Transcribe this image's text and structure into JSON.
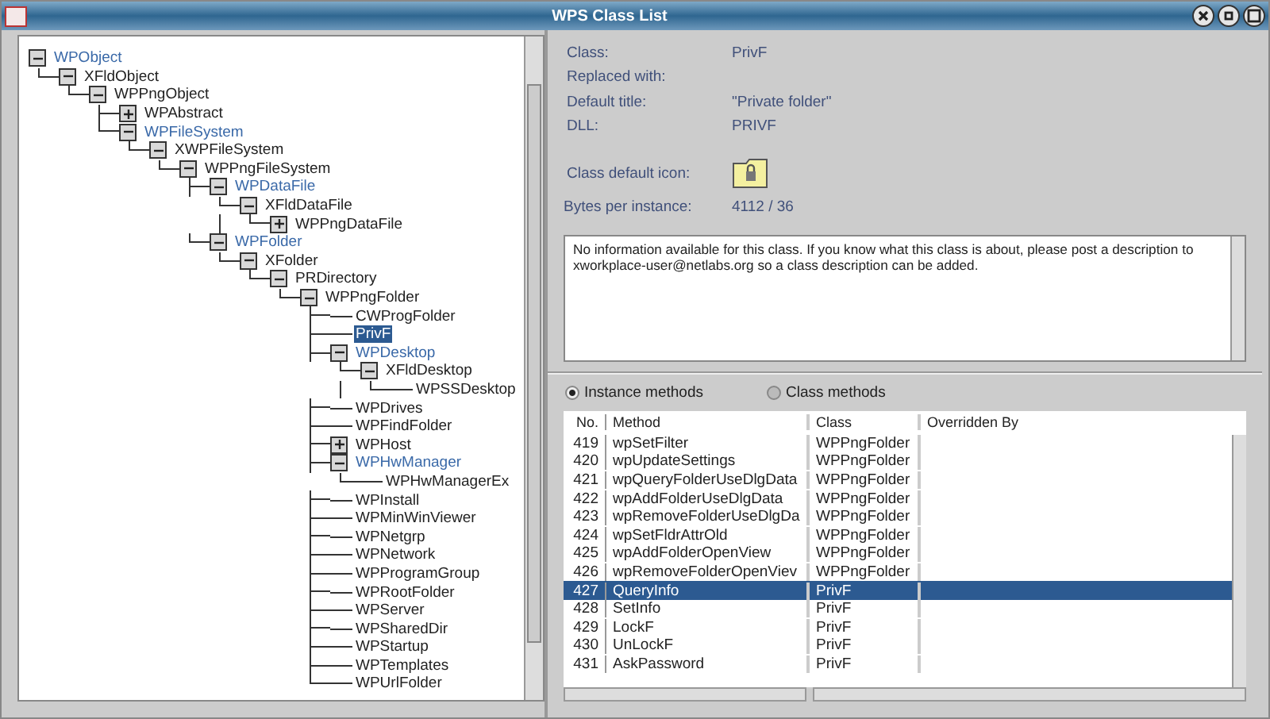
{
  "window": {
    "title": "WPS Class List"
  },
  "tree": [
    {
      "name": "WPObject",
      "kind": "group",
      "expanded": true,
      "highlighted": true,
      "selected": false,
      "children": [
        {
          "name": "XFldObject",
          "kind": "group",
          "expanded": true,
          "highlighted": false,
          "selected": false,
          "children": [
            {
              "name": "WPPngObject",
              "kind": "group",
              "expanded": true,
              "highlighted": false,
              "selected": false,
              "children": [
                {
                  "name": "WPAbstract",
                  "kind": "group",
                  "expanded": false,
                  "highlighted": false,
                  "selected": false
                },
                {
                  "name": "WPFileSystem",
                  "kind": "group",
                  "expanded": true,
                  "highlighted": true,
                  "selected": false,
                  "children": [
                    {
                      "name": "XWPFileSystem",
                      "kind": "group",
                      "expanded": true,
                      "highlighted": false,
                      "selected": false,
                      "children": [
                        {
                          "name": "WPPngFileSystem",
                          "kind": "group",
                          "expanded": true,
                          "highlighted": false,
                          "selected": false,
                          "children": [
                            {
                              "name": "WPDataFile",
                              "kind": "group",
                              "expanded": true,
                              "highlighted": true,
                              "selected": false,
                              "children": [
                                {
                                  "name": "XFldDataFile",
                                  "kind": "group",
                                  "expanded": true,
                                  "highlighted": false,
                                  "selected": false,
                                  "children": [
                                    {
                                      "name": "WPPngDataFile",
                                      "kind": "group",
                                      "expanded": false,
                                      "highlighted": false,
                                      "selected": false
                                    }
                                  ]
                                }
                              ]
                            },
                            {
                              "name": "WPFolder",
                              "kind": "group",
                              "expanded": true,
                              "highlighted": true,
                              "selected": false,
                              "children": [
                                {
                                  "name": "XFolder",
                                  "kind": "group",
                                  "expanded": true,
                                  "highlighted": false,
                                  "selected": false,
                                  "children": [
                                    {
                                      "name": "PRDirectory",
                                      "kind": "group",
                                      "expanded": true,
                                      "highlighted": false,
                                      "selected": false,
                                      "children": [
                                        {
                                          "name": "WPPngFolder",
                                          "kind": "group",
                                          "expanded": true,
                                          "highlighted": false,
                                          "selected": false,
                                          "children": [
                                            {
                                              "name": "CWProgFolder",
                                              "kind": "leaf",
                                              "highlighted": false,
                                              "selected": false
                                            },
                                            {
                                              "name": "PrivF",
                                              "kind": "leaf",
                                              "highlighted": false,
                                              "selected": true
                                            },
                                            {
                                              "name": "WPDesktop",
                                              "kind": "group",
                                              "expanded": true,
                                              "highlighted": true,
                                              "selected": false,
                                              "children": [
                                                {
                                                  "name": "XFldDesktop",
                                                  "kind": "group",
                                                  "expanded": true,
                                                  "highlighted": false,
                                                  "selected": false,
                                                  "children": [
                                                    {
                                                      "name": "WPSSDesktop",
                                                      "kind": "leaf",
                                                      "highlighted": false,
                                                      "selected": false
                                                    }
                                                  ]
                                                }
                                              ]
                                            },
                                            {
                                              "name": "WPDrives",
                                              "kind": "leaf",
                                              "highlighted": false,
                                              "selected": false
                                            },
                                            {
                                              "name": "WPFindFolder",
                                              "kind": "leaf",
                                              "highlighted": false,
                                              "selected": false
                                            },
                                            {
                                              "name": "WPHost",
                                              "kind": "group",
                                              "expanded": false,
                                              "highlighted": false,
                                              "selected": false
                                            },
                                            {
                                              "name": "WPHwManager",
                                              "kind": "group",
                                              "expanded": true,
                                              "highlighted": true,
                                              "selected": false,
                                              "children": [
                                                {
                                                  "name": "WPHwManagerEx",
                                                  "kind": "leaf",
                                                  "highlighted": false,
                                                  "selected": false
                                                }
                                              ]
                                            },
                                            {
                                              "name": "WPInstall",
                                              "kind": "leaf",
                                              "highlighted": false,
                                              "selected": false
                                            },
                                            {
                                              "name": "WPMinWinViewer",
                                              "kind": "leaf",
                                              "highlighted": false,
                                              "selected": false
                                            },
                                            {
                                              "name": "WPNetgrp",
                                              "kind": "leaf",
                                              "highlighted": false,
                                              "selected": false
                                            },
                                            {
                                              "name": "WPNetwork",
                                              "kind": "leaf",
                                              "highlighted": false,
                                              "selected": false
                                            },
                                            {
                                              "name": "WPProgramGroup",
                                              "kind": "leaf",
                                              "highlighted": false,
                                              "selected": false
                                            },
                                            {
                                              "name": "WPRootFolder",
                                              "kind": "leaf",
                                              "highlighted": false,
                                              "selected": false
                                            },
                                            {
                                              "name": "WPServer",
                                              "kind": "leaf",
                                              "highlighted": false,
                                              "selected": false
                                            },
                                            {
                                              "name": "WPSharedDir",
                                              "kind": "leaf",
                                              "highlighted": false,
                                              "selected": false
                                            },
                                            {
                                              "name": "WPStartup",
                                              "kind": "leaf",
                                              "highlighted": false,
                                              "selected": false
                                            },
                                            {
                                              "name": "WPTemplates",
                                              "kind": "leaf",
                                              "highlighted": false,
                                              "selected": false
                                            },
                                            {
                                              "name": "WPUrlFolder",
                                              "kind": "leaf",
                                              "highlighted": false,
                                              "selected": false
                                            }
                                          ]
                                        }
                                      ]
                                    }
                                  ]
                                }
                              ]
                            }
                          ]
                        }
                      ]
                    }
                  ]
                }
              ]
            }
          ]
        }
      ]
    }
  ],
  "info": [
    {
      "label": "Class:",
      "value": "PrivF"
    },
    {
      "label": "Replaced with:"
    },
    {
      "label": "Default title:",
      "value": "\"Private folder\""
    },
    {
      "label": "DLL:",
      "value": "PRIVF"
    }
  ],
  "icon_label": "Class default icon:",
  "bytes": {
    "label": "Bytes per instance:",
    "value": "4112 / 36"
  },
  "description": "No information available for this class. If you know what this class is about, please post a description to xworkplace-user@netlabs.org so a class description can be added.",
  "radios": [
    {
      "label": "Instance methods",
      "selected": true
    },
    {
      "label": "Class methods",
      "selected": false
    }
  ],
  "table": {
    "columns": [
      "No.",
      "Method",
      "Class",
      "Overridden By"
    ],
    "rows": [
      {
        "no": "419",
        "method": "wpSetFilter",
        "class": "WPPngFolder",
        "selected": false
      },
      {
        "no": "420",
        "method": "wpUpdateSettings",
        "class": "WPPngFolder",
        "selected": false
      },
      {
        "no": "421",
        "method": "wpQueryFolderUseDlgData",
        "class": "WPPngFolder",
        "selected": false
      },
      {
        "no": "422",
        "method": "wpAddFolderUseDlgData",
        "class": "WPPngFolder",
        "selected": false
      },
      {
        "no": "423",
        "method": "wpRemoveFolderUseDlgDa",
        "class": "WPPngFolder",
        "selected": false
      },
      {
        "no": "424",
        "method": "wpSetFldrAttrOld",
        "class": "WPPngFolder",
        "selected": false
      },
      {
        "no": "425",
        "method": "wpAddFolderOpenView",
        "class": "WPPngFolder",
        "selected": false
      },
      {
        "no": "426",
        "method": "wpRemoveFolderOpenViev",
        "class": "WPPngFolder",
        "selected": false
      },
      {
        "no": "427",
        "method": "QueryInfo",
        "class": "PrivF",
        "selected": true
      },
      {
        "no": "428",
        "method": "SetInfo",
        "class": "PrivF",
        "selected": false
      },
      {
        "no": "429",
        "method": "LockF",
        "class": "PrivF",
        "selected": false
      },
      {
        "no": "430",
        "method": "UnLockF",
        "class": "PrivF",
        "selected": false
      },
      {
        "no": "431",
        "method": "AskPassword",
        "class": "PrivF",
        "selected": false
      }
    ]
  }
}
